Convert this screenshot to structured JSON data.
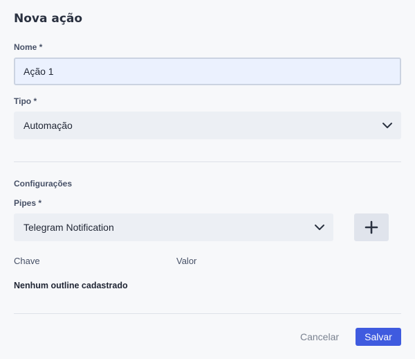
{
  "form": {
    "title": "Nova ação",
    "name_label": "Nome *",
    "name_value": "Ação 1",
    "type_label": "Tipo *",
    "type_value": "Automação",
    "config_heading": "Configurações",
    "pipes_label": "Pipes *",
    "pipes_value": "Telegram Notification",
    "table_headers": [
      "Chave",
      "Valor"
    ],
    "empty_message": "Nenhum outline cadastrado",
    "cancel_label": "Cancelar",
    "save_label": "Salvar"
  },
  "icons": {
    "dropdown": "chevron-down-icon",
    "add": "plus-icon"
  },
  "colors": {
    "primary": "#3f5bdf",
    "input_bg": "#ebf1fe",
    "select_bg": "#eceff4"
  }
}
